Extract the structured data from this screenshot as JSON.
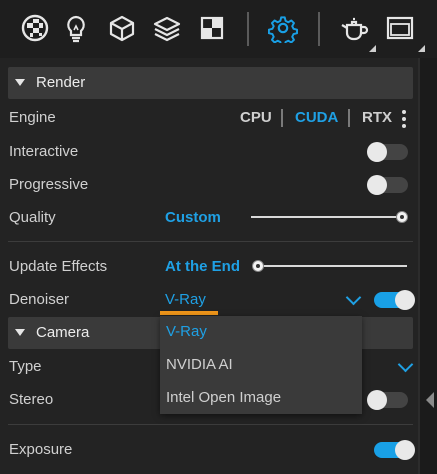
{
  "toolbar": {
    "icons": [
      "material-ball-icon",
      "lightbulb-icon",
      "cube-icon",
      "layers-icon",
      "checker-square-icon",
      "gear-icon",
      "teapot-icon",
      "window-icon"
    ],
    "active_icon": "gear-icon",
    "accent": "#19a0e6"
  },
  "render": {
    "title": "Render",
    "engine": {
      "label": "Engine",
      "options": [
        "CPU",
        "CUDA",
        "RTX"
      ],
      "selected": "CUDA"
    },
    "interactive": {
      "label": "Interactive",
      "on": false
    },
    "progressive": {
      "label": "Progressive",
      "on": false
    },
    "quality": {
      "label": "Quality",
      "value": "Custom",
      "slider_fraction": 1.0
    },
    "update_effects": {
      "label": "Update Effects",
      "value": "At the End",
      "slider_fraction": 0.0
    },
    "denoiser": {
      "label": "Denoiser",
      "value": "V-Ray",
      "on": true,
      "options": [
        "V-Ray",
        "NVIDIA AI",
        "Intel Open Image"
      ]
    }
  },
  "camera": {
    "title": "Camera",
    "type": {
      "label": "Type"
    },
    "stereo": {
      "label": "Stereo",
      "on": false
    },
    "exposure": {
      "label": "Exposure",
      "on": true
    }
  },
  "colors": {
    "accent_blue": "#1fa0e4",
    "orange_underline": "#f0961a"
  }
}
